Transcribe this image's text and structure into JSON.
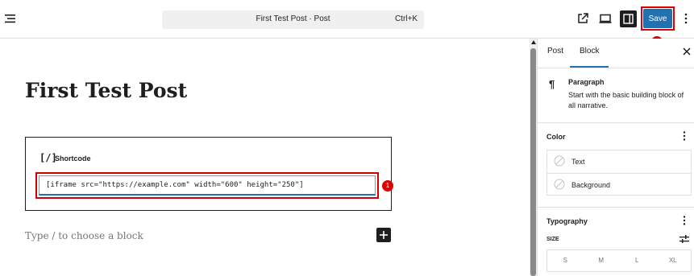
{
  "topbar": {
    "document_title": "First Test Post · Post",
    "shortcut": "Ctrl+K",
    "save_label": "Save",
    "annotation_save": "2"
  },
  "editor": {
    "post_title": "First Test Post",
    "shortcode_label": "Shortcode",
    "shortcode_icon": "[/]",
    "shortcode_value": "[iframe src=\"https://example.com\" width=\"600\" height=\"250\"]",
    "annotation_input": "1",
    "block_placeholder": "Type / to choose a block"
  },
  "sidebar": {
    "tabs": [
      {
        "label": "Post",
        "active": false
      },
      {
        "label": "Block",
        "active": true
      }
    ],
    "block_card": {
      "icon": "¶",
      "name": "Paragraph",
      "description": "Start with the basic building block of all narrative."
    },
    "color_panel": {
      "title": "Color",
      "items": [
        {
          "label": "Text"
        },
        {
          "label": "Background"
        }
      ]
    },
    "typography_panel": {
      "title": "Typography",
      "size_label": "SIZE",
      "sizes": [
        "S",
        "M",
        "L",
        "XL"
      ]
    }
  },
  "colors": {
    "accent": "#2271b1",
    "annotation": "#e00000",
    "text": "#1e1e1e"
  },
  "icons": [
    "menu-icon",
    "external-link-icon",
    "desktop-preview-icon",
    "sidebar-toggle-icon",
    "more-vertical-icon",
    "plus-icon",
    "close-icon",
    "paragraph-icon",
    "no-color-icon",
    "settings-sliders-icon"
  ]
}
